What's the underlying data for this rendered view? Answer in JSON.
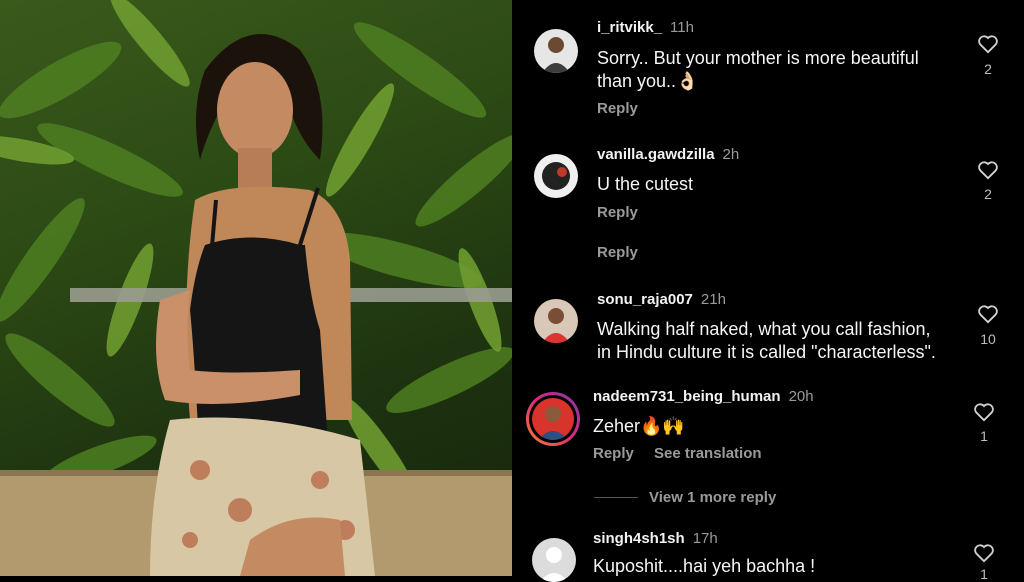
{
  "comments": [
    {
      "user": "i_ritvikk_",
      "time": "11h",
      "line1": "Sorry.. But your mother is more beautiful",
      "line2": "than you..👌🏻",
      "reply": "Reply",
      "likes": "2"
    },
    {
      "user": "vanilla.gawdzilla",
      "time": "2h",
      "line1": "U the cutest",
      "reply": "Reply",
      "likes": "2"
    },
    {
      "reply": "Reply"
    },
    {
      "user": "sonu_raja007",
      "time": "21h",
      "line1": "Walking half naked, what you call fashion,",
      "line2": "in Hindu culture it is called \"characterless\".",
      "likes": "10"
    },
    {
      "user": "nadeem731_being_human",
      "time": "20h",
      "line1": "Zeher🔥🙌",
      "reply": "Reply",
      "translate": "See translation",
      "likes": "1",
      "view_more": "View 1 more reply"
    },
    {
      "user": "singh4sh1sh",
      "time": "17h",
      "line1": "Kuposhit....hai yeh bachha !",
      "likes": "1"
    }
  ],
  "colors": {
    "background": "#000000",
    "secondary_text": "#9a9a9a",
    "story_ring": "#c13584"
  },
  "icons": {
    "like": "heart-outline-icon"
  }
}
